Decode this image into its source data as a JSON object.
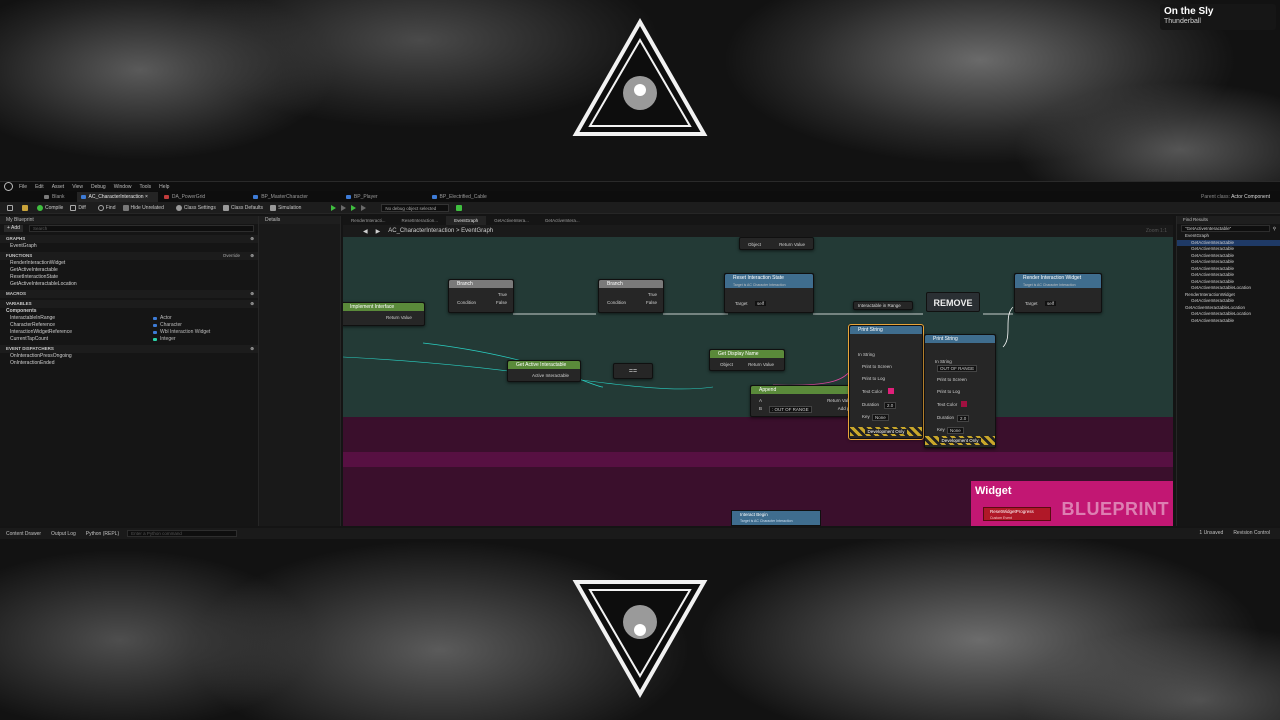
{
  "channel": {
    "name": "On the Sly",
    "subtitle": "Thunderball"
  },
  "menu": [
    "File",
    "Edit",
    "Asset",
    "View",
    "Debug",
    "Window",
    "Tools",
    "Help"
  ],
  "tabs": [
    {
      "label": "Blank",
      "color": "#7a7a7a",
      "active": false
    },
    {
      "label": "AC_CharacterInteraction",
      "color": "#3d7bd6",
      "active": true
    },
    {
      "label": "DA_PowerGrid",
      "color": "#c03c3c",
      "active": false
    },
    {
      "label": "BP_MasterCharacter",
      "color": "#3d7bd6",
      "active": false
    },
    {
      "label": "BP_Player",
      "color": "#3d7bd6",
      "active": false
    },
    {
      "label": "BP_Electrified_Cable",
      "color": "#3d7bd6",
      "active": false
    }
  ],
  "parent_class": {
    "label": "Parent class:",
    "value": "Actor Component"
  },
  "toolbar": {
    "compile": "Compile",
    "diff": "Diff",
    "find": "Find",
    "hide_unrelated": "Hide Unrelated",
    "class_settings": "Class Settings",
    "class_defaults": "Class Defaults",
    "simulation": "Simulation",
    "debug_select": "No debug object selected"
  },
  "left_panel": {
    "title": "My Blueprint",
    "add": "+ Add",
    "search_placeholder": "Search",
    "graphs_header": "GRAPHS",
    "graphs": [
      "EventGraph"
    ],
    "functions_header": "FUNCTIONS",
    "override": "Override",
    "functions": [
      "RenderInteractionWidget",
      "GetActiveInteractable",
      "ResetInteractionState",
      "GetActiveInteractableLocation"
    ],
    "macros_header": "MACROS",
    "variables_header": "VARIABLES",
    "components_label": "Components",
    "variables": [
      {
        "name": "InteractableInRange",
        "type": "Actor",
        "color": "#3d7bd6"
      },
      {
        "name": "CharacterReference",
        "type": "Character",
        "color": "#3d7bd6"
      },
      {
        "name": "InteractionWidgetReference",
        "type": "Wbl Interaction Widget",
        "color": "#3d7bd6"
      },
      {
        "name": "CurrentTapCount",
        "type": "Integer",
        "color": "#2bd3a8"
      }
    ],
    "dispatchers_header": "EVENT DISPATCHERS",
    "dispatchers": [
      "OnInteractionPressOngoing",
      "OnInteractionEnded"
    ]
  },
  "details": {
    "title": "Details"
  },
  "graph_tabs": [
    "RenderInteracti...",
    "ResetInteraction...",
    "EventGraph",
    "GetActiveIntera...",
    "GetActiveIntera..."
  ],
  "breadcrumb": "AC_CharacterInteraction > EventGraph",
  "zoom": "Zoom 1:1",
  "nodes": {
    "branch1": {
      "title": "Branch",
      "condition": "Condition",
      "true": "True",
      "false": "False"
    },
    "branch2": {
      "title": "Branch",
      "condition": "Condition",
      "true": "True",
      "false": "False"
    },
    "reset_state": {
      "title": "Reset Interaction State",
      "sub": "Target is AC Character Interaction",
      "target": "Target",
      "self": "self"
    },
    "render_widget": {
      "title": "Render Interaction Widget",
      "sub": "Target is AC Character Interaction",
      "target": "Target",
      "self": "self"
    },
    "implement": {
      "title": "Implement Interface",
      "ret": "Return Value"
    },
    "get_active": {
      "title": "Get Active Interactable",
      "ret": "Active Interactable"
    },
    "get_display": {
      "title": "Get Display Name",
      "object": "Object",
      "ret": "Return Value"
    },
    "get_display_top": {
      "title": "Get Display Name",
      "object": "Object",
      "ret": "Return Value"
    },
    "append": {
      "title": "Append",
      "a": "A",
      "b": "B",
      "b_value": ": OUT OF RANGE",
      "ret": "Return Value",
      "add_pin": "Add pin"
    },
    "remove": "REMOVE",
    "in_range": "Interactable in Range",
    "print1": {
      "title": "Print String",
      "in_string": "In String",
      "print_screen": "Print to Screen",
      "print_log": "Print to Log",
      "text_color": "Text Color",
      "duration": "Duration",
      "duration_val": "2.0",
      "key": "Key",
      "key_val": "None",
      "dev_only": "Development Only"
    },
    "print2": {
      "title": "Print String",
      "in_string": "In String",
      "in_string_val": "OUT OF RANGE",
      "print_screen": "Print to Screen",
      "print_log": "Print to Log",
      "text_color": "Text Color",
      "duration": "Duration",
      "duration_val": "2.0",
      "key": "Key",
      "key_val": "None",
      "dev_only": "Development Only"
    },
    "interact_begin": {
      "title": "Interact Begin",
      "sub": "Target is AC Character Interaction"
    },
    "widget_comment": "Widget",
    "blueprint_label": "BLUEPRINT",
    "reset_progress": {
      "title": "ResetWidgetProgress",
      "sub": "Custom Event"
    }
  },
  "right_panel": {
    "title": "Find Results",
    "search_value": "\"GetActiveInteractable\"",
    "results": [
      {
        "label": "EventGraph",
        "highlight": false
      },
      {
        "label": "GetActiveInteractable",
        "highlight": true
      },
      {
        "label": "GetActiveInteractable",
        "highlight": false
      },
      {
        "label": "GetActiveInteractable",
        "highlight": false
      },
      {
        "label": "GetActiveInteractable",
        "highlight": false
      },
      {
        "label": "GetActiveInteractable",
        "highlight": false
      },
      {
        "label": "GetActiveInteractable",
        "highlight": false
      },
      {
        "label": "GetActiveInteractable",
        "highlight": false
      },
      {
        "label": "GetActiveInteractableLocation",
        "highlight": false
      },
      {
        "label": "RenderInteractionWidget",
        "highlight": false
      },
      {
        "label": "GetActiveInteractable",
        "highlight": false
      },
      {
        "label": "GetActiveInteractableLocation",
        "highlight": false
      },
      {
        "label": "GetActiveInteractableLocation",
        "highlight": false
      },
      {
        "label": "GetActiveInteractable",
        "highlight": false
      }
    ]
  },
  "statusbar": {
    "content_drawer": "Content Drawer",
    "output_log": "Output Log",
    "python": "Python (REPL)",
    "cmd_placeholder": "Enter a Python command",
    "unsaved": "1 Unsaved",
    "revision": "Revision Control"
  }
}
